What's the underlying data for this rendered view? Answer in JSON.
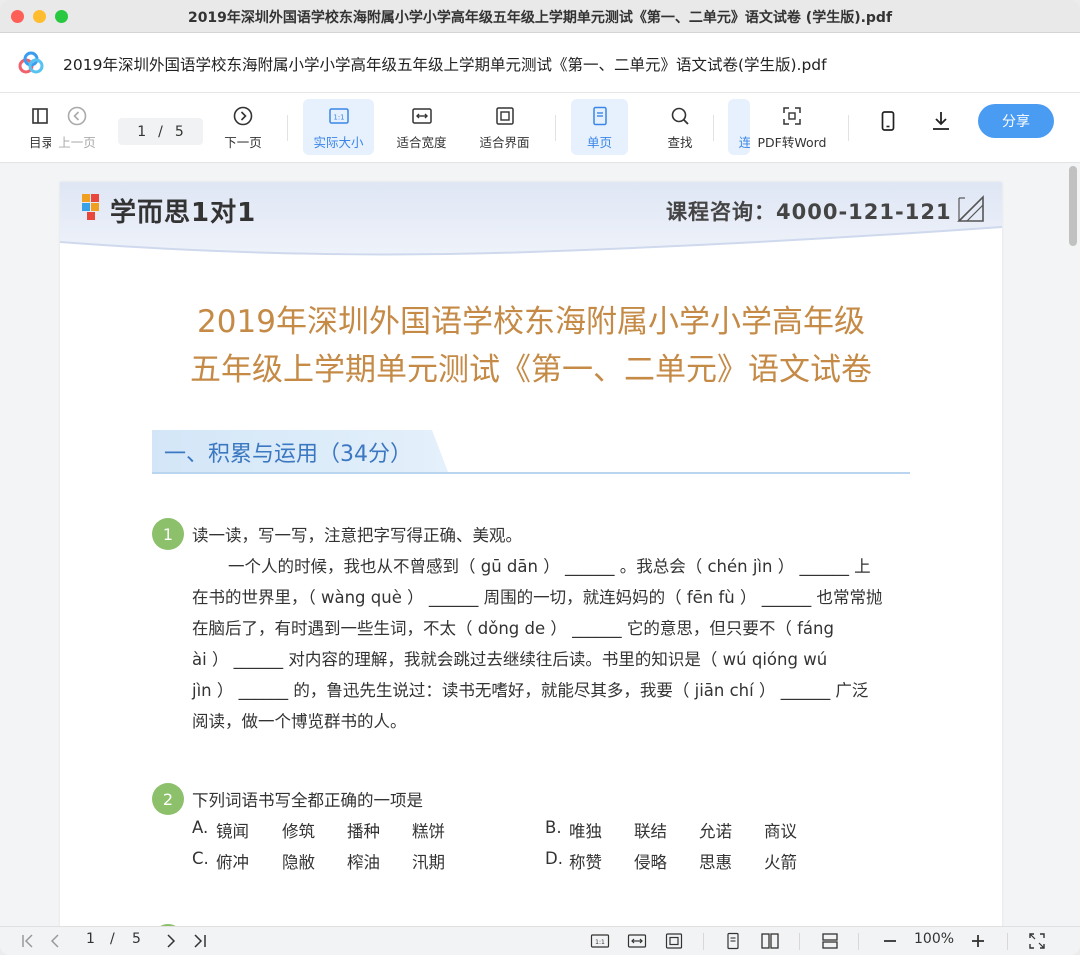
{
  "window": {
    "title": "2019年深圳外国语学校东海附属小学小学高年级五年级上学期单元测试《第一、二单元》语文试卷 (学生版).pdf"
  },
  "doc_header": {
    "title": "2019年深圳外国语学校东海附属小学小学高年级五年级上学期单元测试《第一、二单元》语文试卷(学生版).pdf"
  },
  "toolbar": {
    "toc_label": "目录",
    "prev_label": "上一页",
    "page_current": "1",
    "page_sep": "/",
    "page_total": "5",
    "next_label": "下一页",
    "actual_size_label": "实际大小",
    "fit_width_label": "适合宽度",
    "fit_page_label": "适合界面",
    "single_page_label": "单页",
    "find_label": "查找",
    "continuous_label": "连",
    "pdf_to_word_label": "PDF转Word",
    "share_label": "分享"
  },
  "page": {
    "brand": "学而思1对1",
    "consult": "课程咨询：4000-121-121",
    "heading_line1": "2019年深圳外国语学校东海附属小学小学高年级",
    "heading_line2": "五年级上学期单元测试《第一、二单元》语文试卷",
    "section_title": "一、积累与运用（34分）",
    "q1": {
      "num": "1",
      "title": "读一读，写一写，注意把字写得正确、美观。",
      "lines": [
        "一个人的时候，我也从不曾感到（ gū dān ） ______ 。我总会（ chén jìn ） ______ 上",
        "在书的世界里，（ wàng què ） ______ 周围的一切，就连妈妈的（ fēn fù ） ______ 也常常抛",
        "在脑后了，有时遇到一些生词，不太（ dǒng de ） ______ 它的意思，但只要不（ fáng",
        "ài ） ______ 对内容的理解，我就会跳过去继续往后读。书里的知识是（ wú qióng wú",
        "jìn ） ______ 的，鲁迅先生说过：读书无嗜好，就能尽其多，我要（ jiān chí ） ______ 广泛",
        "阅读，做一个博览群书的人。"
      ]
    },
    "q2": {
      "num": "2",
      "title": "下列词语书写全都正确的一项是",
      "options": [
        {
          "label": "A.",
          "words": [
            "镜闻",
            "修筑",
            "播种",
            "糕饼"
          ]
        },
        {
          "label": "B.",
          "words": [
            "唯独",
            "联结",
            "允诺",
            "商议"
          ]
        },
        {
          "label": "C.",
          "words": [
            "俯冲",
            "隐敝",
            "榨油",
            "汛期"
          ]
        },
        {
          "label": "D.",
          "words": [
            "称赞",
            "侵略",
            "思惠",
            "火箭"
          ]
        }
      ]
    }
  },
  "statusbar": {
    "page_current": "1",
    "page_sep": "/",
    "page_total": "5",
    "zoom": "100%"
  },
  "colors": {
    "accent": "#3a86e8",
    "share": "#4a9bf2",
    "heading": "#c48a46",
    "section": "#3c78c2",
    "qnum": "#8cc06a"
  }
}
